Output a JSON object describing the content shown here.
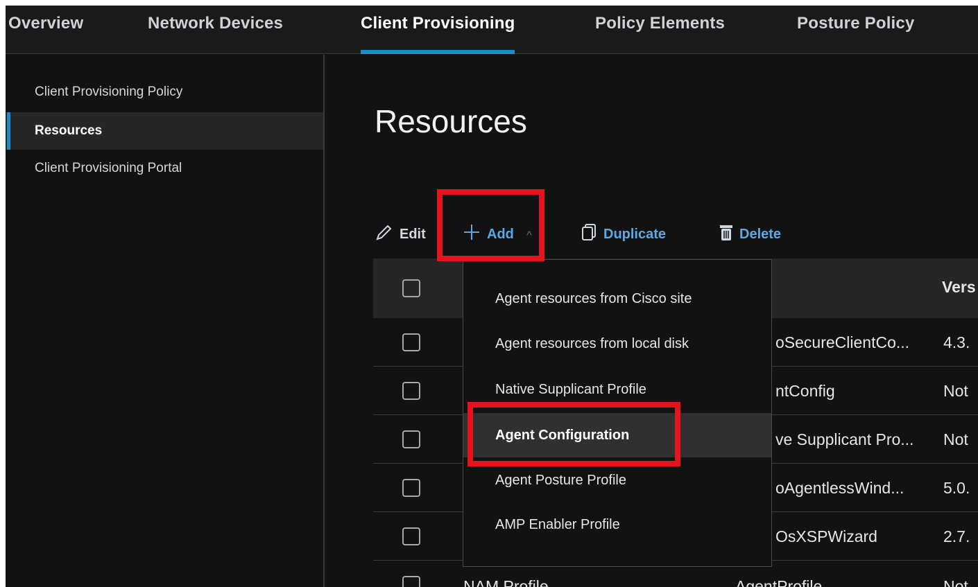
{
  "nav": {
    "tabs": [
      {
        "label": "Overview"
      },
      {
        "label": "Network Devices"
      },
      {
        "label": "Client Provisioning"
      },
      {
        "label": "Policy Elements"
      },
      {
        "label": "Posture Policy"
      }
    ]
  },
  "sidebar": {
    "items": [
      {
        "label": "Client Provisioning Policy"
      },
      {
        "label": "Resources"
      },
      {
        "label": "Client Provisioning Portal"
      }
    ]
  },
  "main": {
    "title": "Resources",
    "toolbar": {
      "edit_label": "Edit",
      "add_label": "Add",
      "duplicate_label": "Duplicate",
      "delete_label": "Delete"
    },
    "table": {
      "header_version": "Vers",
      "rows": [
        {
          "type": "oSecureClientCo...",
          "version": "4.3."
        },
        {
          "type": "ntConfig",
          "version": "Not"
        },
        {
          "type": "ve Supplicant Pro...",
          "version": "Not"
        },
        {
          "type": "oAgentlessWind...",
          "version": "5.0."
        },
        {
          "type": "OsXSPWizard",
          "version": "2.7."
        },
        {
          "name": "NAM Profile",
          "type": "AgentProfile",
          "version": "Not"
        }
      ]
    }
  },
  "dropdown": {
    "items": [
      {
        "label": "Agent resources from Cisco site"
      },
      {
        "label": "Agent resources from local disk"
      },
      {
        "label": "Native Supplicant Profile"
      },
      {
        "label": "Agent Configuration"
      },
      {
        "label": "Agent Posture Profile"
      },
      {
        "label": "AMP Enabler Profile"
      }
    ]
  },
  "icons": {
    "edit": "pencil-icon",
    "add": "plus-icon",
    "duplicate": "copy-icon",
    "delete": "trash-icon"
  },
  "colors": {
    "accent": "#1e8bc3",
    "link": "#5aa9e6",
    "highlight_box": "#e3141b"
  }
}
